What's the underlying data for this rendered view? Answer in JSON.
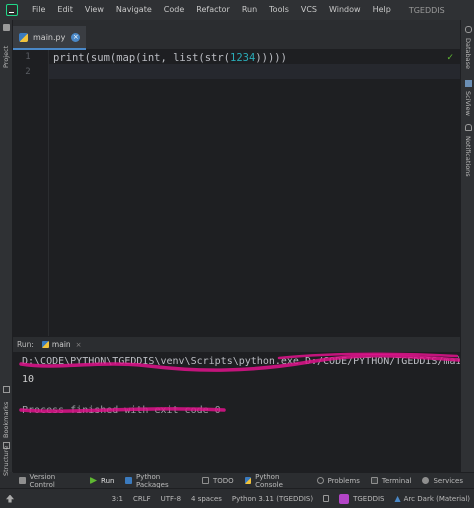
{
  "menu": {
    "items": [
      "File",
      "Edit",
      "View",
      "Navigate",
      "Code",
      "Refactor",
      "Run",
      "Tools",
      "VCS",
      "Window",
      "Help"
    ],
    "project_name": "TGEDDIS"
  },
  "left_strip": {
    "top_label": "Project",
    "bottom_labels": [
      "Bookmarks",
      "Structure"
    ]
  },
  "right_strip": {
    "labels": [
      "Database",
      "SciView",
      "Notifications"
    ]
  },
  "editor": {
    "tab_label": "main.py",
    "line_numbers": [
      "1",
      "2"
    ],
    "code_prefix": "print(sum(map(int, list(str(",
    "code_number": "1234",
    "code_suffix": ")))))"
  },
  "run_panel": {
    "title": "Run:",
    "tab_label": "main",
    "command_line": "D:\\CODE\\PYTHON\\TGEDDIS\\venv\\Scripts\\python.exe D:/CODE/PYTHON/TGEDDIS/mai",
    "output": "10",
    "finish_line": "Process finished with exit code 0"
  },
  "bottom_tools": [
    {
      "label": "Version Control",
      "icon": "version-control-icon",
      "color": "#8f8f8f"
    },
    {
      "label": "Run",
      "icon": "run-icon",
      "color": "#5fb832"
    },
    {
      "label": "Python Packages",
      "icon": "python-packages-icon",
      "color": "#3b7bbf"
    },
    {
      "label": "TODO",
      "icon": "todo-icon",
      "color": "#8f8f8f"
    },
    {
      "label": "Python Console",
      "icon": "python-console-icon",
      "color": "#f0c23b"
    },
    {
      "label": "Problems",
      "icon": "problems-icon",
      "color": "#8f8f8f"
    },
    {
      "label": "Terminal",
      "icon": "terminal-icon",
      "color": "#8f8f8f"
    },
    {
      "label": "Services",
      "icon": "services-icon",
      "color": "#8f8f8f"
    }
  ],
  "status": {
    "position": "3:1",
    "line_sep": "CRLF",
    "encoding": "UTF-8",
    "indent": "4 spaces",
    "interpreter": "Python 3.11 (TGEDDIS)",
    "project": "TGEDDIS",
    "theme": "Arc Dark (Material)"
  },
  "colors": {
    "accent": "#4a88c7",
    "scribble": "#e0138c",
    "success": "#5fb832"
  }
}
